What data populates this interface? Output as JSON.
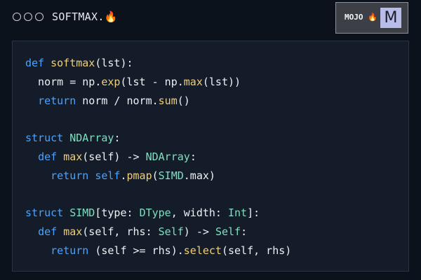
{
  "window": {
    "title": "SOFTMAX.",
    "title_icon": "🔥",
    "dots": [
      "dot",
      "dot",
      "dot"
    ]
  },
  "badge": {
    "label": "MOJO",
    "icon": "🔥",
    "logo_letter": "M"
  },
  "colors": {
    "background": "#0b121c",
    "panel": "#131c28",
    "keyword": "#4aa3ff",
    "type": "#7ee0c0",
    "function": "#f1cf7a",
    "text": "#eef1f5"
  },
  "code_lines": [
    [
      {
        "t": "def ",
        "c": "kw"
      },
      {
        "t": "softmax",
        "c": "fn"
      },
      {
        "t": "(lst):",
        "c": "plain"
      }
    ],
    [
      {
        "t": "  norm = np.",
        "c": "plain"
      },
      {
        "t": "exp",
        "c": "fn"
      },
      {
        "t": "(lst - np.",
        "c": "plain"
      },
      {
        "t": "max",
        "c": "fn"
      },
      {
        "t": "(lst))",
        "c": "plain"
      }
    ],
    [
      {
        "t": "  ",
        "c": "plain"
      },
      {
        "t": "return",
        "c": "kw"
      },
      {
        "t": " norm / norm.",
        "c": "plain"
      },
      {
        "t": "sum",
        "c": "fn"
      },
      {
        "t": "()",
        "c": "plain"
      }
    ],
    [],
    [
      {
        "t": "struct ",
        "c": "kw"
      },
      {
        "t": "NDArray",
        "c": "type"
      },
      {
        "t": ":",
        "c": "plain"
      }
    ],
    [
      {
        "t": "  ",
        "c": "plain"
      },
      {
        "t": "def ",
        "c": "kw"
      },
      {
        "t": "max",
        "c": "fn"
      },
      {
        "t": "(self) -> ",
        "c": "plain"
      },
      {
        "t": "NDArray",
        "c": "type"
      },
      {
        "t": ":",
        "c": "plain"
      }
    ],
    [
      {
        "t": "    ",
        "c": "plain"
      },
      {
        "t": "return ",
        "c": "kw"
      },
      {
        "t": "self",
        "c": "kw"
      },
      {
        "t": ".",
        "c": "plain"
      },
      {
        "t": "pmap",
        "c": "fn"
      },
      {
        "t": "(",
        "c": "plain"
      },
      {
        "t": "SIMD",
        "c": "type"
      },
      {
        "t": ".max)",
        "c": "plain"
      }
    ],
    [],
    [
      {
        "t": "struct ",
        "c": "kw"
      },
      {
        "t": "SIMD",
        "c": "type"
      },
      {
        "t": "[type: ",
        "c": "plain"
      },
      {
        "t": "DType",
        "c": "type"
      },
      {
        "t": ", width: ",
        "c": "plain"
      },
      {
        "t": "Int",
        "c": "type"
      },
      {
        "t": "]:",
        "c": "plain"
      }
    ],
    [
      {
        "t": "  ",
        "c": "plain"
      },
      {
        "t": "def ",
        "c": "kw"
      },
      {
        "t": "max",
        "c": "fn"
      },
      {
        "t": "(self, rhs: ",
        "c": "plain"
      },
      {
        "t": "Self",
        "c": "type"
      },
      {
        "t": ") -> ",
        "c": "plain"
      },
      {
        "t": "Self",
        "c": "type"
      },
      {
        "t": ":",
        "c": "plain"
      }
    ],
    [
      {
        "t": "    ",
        "c": "plain"
      },
      {
        "t": "return",
        "c": "kw"
      },
      {
        "t": " (self >= rhs).",
        "c": "plain"
      },
      {
        "t": "select",
        "c": "fn"
      },
      {
        "t": "(self, rhs)",
        "c": "plain"
      }
    ]
  ]
}
